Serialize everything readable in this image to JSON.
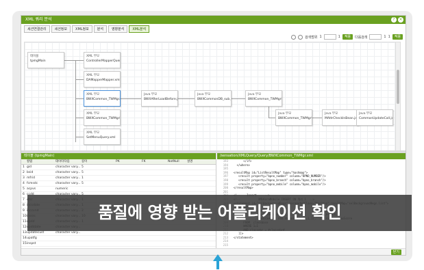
{
  "app": {
    "title": "XML 쿼리 분석"
  },
  "tabs": [
    {
      "label": "세션연결관리"
    },
    {
      "label": "세션정보"
    },
    {
      "label": "XML정보"
    },
    {
      "label": "분석"
    },
    {
      "label": "영향분석"
    },
    {
      "label": "XML분석"
    }
  ],
  "toolbar": {
    "label1": "검색범위",
    "num1": "1",
    "num2": "1",
    "go": "적용",
    "label2": "다음검색",
    "num3": "1",
    "num4": "1",
    "btn": "적용"
  },
  "graph": {
    "root": {
      "title": "테이블",
      "sub": "tpmgMain"
    },
    "nodes": [
      {
        "title": "XML 부모",
        "sub": "ControllerMapperQuery.xml"
      },
      {
        "title": "XML 부모",
        "sub": "DAMapperMapper.xml"
      },
      {
        "title": "XML 부모",
        "sub": "BWXCommon_TWMgr.xml"
      },
      {
        "title": "XML 부모",
        "sub": "BWXCommon_TWMgrList.xml"
      },
      {
        "title": "XML 부모",
        "sub": "SetMenuQuery.xml"
      },
      {
        "title": "Java 부모",
        "sub": "BWXAfterLoadBefore.java"
      },
      {
        "title": "Java 부모",
        "sub": "BWXCommonDB_sub.java"
      },
      {
        "title": "Java 부모",
        "sub": "BWXCommon_TWMgrMgr.java"
      },
      {
        "title": "Java 부모",
        "sub": "BWXCommon_TWMgrS.java"
      },
      {
        "title": "Java 부모",
        "sub": "MAttrCheckInBean.java"
      },
      {
        "title": "Java 부모",
        "sub": "CommonUpdateCall.java"
      }
    ]
  },
  "left_panel": {
    "title": "테이블 (tpmgMain)",
    "columns": [
      "",
      "컬럼",
      "데이터타입",
      "길이",
      "PK",
      "FK",
      "NotNull",
      "설명"
    ],
    "rows": [
      [
        "1",
        "gid",
        "character vary...",
        "5",
        "",
        "",
        "",
        ""
      ],
      [
        "2",
        "bsid",
        "character vary...",
        "5",
        "",
        "",
        "",
        ""
      ],
      [
        "3",
        "mfrid",
        "character vary...",
        "1",
        "",
        "",
        "",
        ""
      ],
      [
        "4",
        "fcmsdc",
        "character vary...",
        "5",
        "",
        "",
        "",
        ""
      ],
      [
        "5",
        "acpvs",
        "numeric",
        "",
        "",
        "",
        "",
        ""
      ],
      [
        "6",
        "ccdd",
        "character vary...",
        "5",
        "",
        "",
        "",
        ""
      ],
      [
        "7",
        "dtcr",
        "character vary...",
        "1",
        "",
        "",
        "",
        ""
      ],
      [
        "8",
        "inccdate",
        "character vary...",
        "1",
        "",
        "",
        "",
        ""
      ],
      [
        "9",
        "inccvnd",
        "character vary...",
        "2",
        "",
        "",
        "",
        ""
      ],
      [
        "10",
        "inssrc",
        "character vary...",
        "10",
        "",
        "",
        "",
        ""
      ],
      [
        "11",
        "updd",
        "character vary...",
        "1",
        "",
        "",
        "",
        ""
      ],
      [
        "12",
        "updtdate",
        "character vary...",
        "",
        "",
        "",
        "",
        ""
      ],
      [
        "13",
        "updatecust",
        "character vary...",
        "",
        "",
        "",
        "",
        ""
      ],
      [
        "14",
        "upatfg",
        "",
        "",
        "",
        "",
        "",
        ""
      ],
      [
        "15",
        "inspst",
        "",
        "",
        "",
        "",
        "",
        ""
      ]
    ]
  },
  "right_panel": {
    "title": "/sensation/XMLQuery/Query/BWXCommon_TWMgr.xml",
    "lines": [
      {
        "n": "193",
        "t": "        </if>"
      },
      {
        "n": "194",
        "t": "    </where>"
      },
      {
        "n": "195",
        "t": ""
      },
      {
        "n": "196",
        "t": "  <resultMap id=\"ListResultMap\" type=\"hashmap\">"
      },
      {
        "n": "197",
        "t": "     <result property=\"bpno_number\" column=\"BPNO_NUMBER\"/>"
      },
      {
        "n": "198",
        "t": "     <result property=\"bpno_branch\" column=\"bpno_branch\"/>"
      },
      {
        "n": "199",
        "t": "     <result property=\"bpno_mobile\" column=\"bpno_mobile\"/>"
      },
      {
        "n": "200",
        "t": "  </resultMap>"
      },
      {
        "n": "201",
        "t": ""
      },
      {
        "n": "202",
        "t": "  <!--    Insert     -->"
      },
      {
        "n": "203",
        "t": "  <!--           XMLKoraMobile INSERT ON 쿼리 1  -->"
      },
      {
        "n": "204",
        "t": "  <statement id=\"selBackgroundRegs\" parameterClass=\"hashmap\" resultMap=\"selBackgroundRegs.list\">"
      },
      {
        "n": "205",
        "t": "     <![CDATA["
      },
      {
        "n": "206",
        "t": "        SELECT a.classnbr                         AS bpno_number"
      },
      {
        "n": "207",
        "t": "               ,NVL(TRUNC(a.branch,1),'N')        AS bpno_branch"
      },
      {
        "n": "208",
        "t": "               ,(case(Sector dtm.Values.scorde,1,1),'')   AS bpno_maxScore"
      },
      {
        "n": "209",
        "t": "        FROM  classbase"
      },
      {
        "n": "210",
        "t": "        WHERE 1=1"
      },
      {
        "n": "211",
        "t": "        AND classnbr = #classnbr#"
      },
      {
        "n": "212",
        "t": "     ]]>"
      },
      {
        "n": "213",
        "t": "  </statement>"
      },
      {
        "n": "214",
        "t": ""
      },
      {
        "n": "215",
        "t": ""
      }
    ]
  },
  "banner": {
    "text": "품질에 영향 받는 어플리케이션 확인"
  },
  "status": {
    "btn": "닫기"
  },
  "colors": {
    "accent": "#6aa121",
    "arrow": "#2aa3d6",
    "banner_bg": "#3c3c3c"
  }
}
